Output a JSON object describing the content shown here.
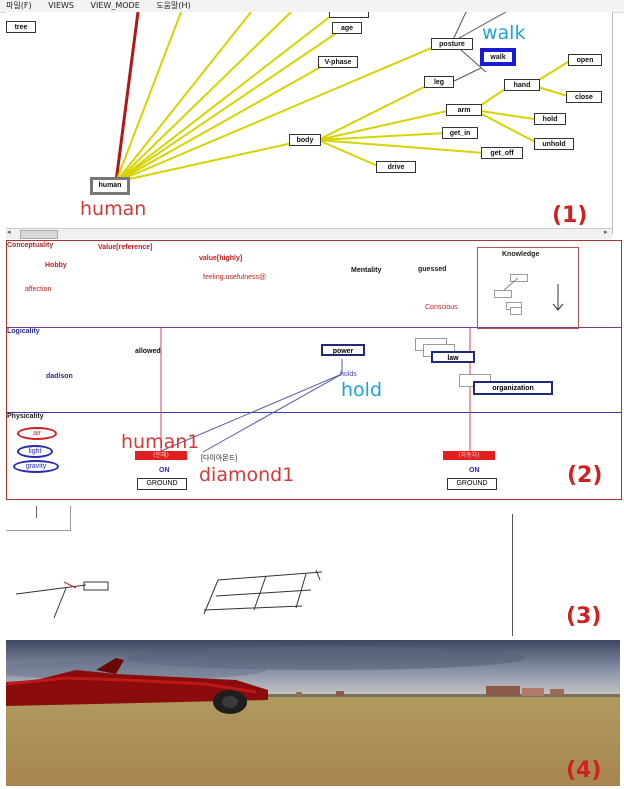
{
  "menu": [
    "파일(F)",
    "VIEWS",
    "VIEW_MODE",
    "도움말(H)"
  ],
  "panel1": {
    "tree_button": "tree",
    "nodes": {
      "age": "age",
      "vphase": "V-phase",
      "posture": "posture",
      "walk": "walk",
      "open": "open",
      "hand": "hand",
      "close": "close",
      "leg": "leg",
      "arm": "arm",
      "hold": "hold",
      "unhold": "unhold",
      "get_in": "get_in",
      "body": "body",
      "get_off": "get_off",
      "drive": "drive",
      "human": "human"
    },
    "overlay_walk": "walk",
    "overlay_human": "human",
    "number": "(1)"
  },
  "panel2": {
    "conceptuality": {
      "title": "Conceptuality",
      "value_reference": "Value[reference]",
      "hobby": "Hobby",
      "value_highly": "value[highly]",
      "feeling": "feeling.usefulness@",
      "affection": "affection",
      "mentality": "Mentality",
      "guessed": "guessed",
      "conscious": "Conscious",
      "knowledge": "Knowledge"
    },
    "logicality": {
      "title": "Logicality",
      "allowed": "allowed",
      "power": "power",
      "law": "law",
      "dad_son": "dad/son",
      "holds": "holds",
      "organization": "organization",
      "overlay_hold": "hold"
    },
    "physicality": {
      "title": "Physicality",
      "air": "air",
      "light": "light",
      "gravity": "gravity",
      "human_box": "(인체)",
      "diamond_text": "[다이아몬드]",
      "car_box": "(자동차)",
      "on1": "ON",
      "ground1": "GROUND",
      "on2": "ON",
      "ground2": "GROUND",
      "overlay_human1": "human1",
      "overlay_diamond1": "diamond1"
    },
    "number": "(2)"
  },
  "panel3": {
    "number": "(3)"
  },
  "panel4": {
    "number": "(4)"
  },
  "colors": {
    "red_label": "#d23a3a",
    "blue_label": "#1fa2d8",
    "edge_yellow": "#d6d400",
    "edge_red": "#b01818",
    "node_blue": "#202a7a"
  }
}
